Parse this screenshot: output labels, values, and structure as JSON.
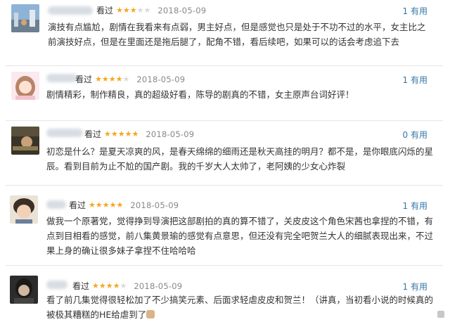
{
  "reviews": [
    {
      "rated_label": "看过",
      "rating": 3,
      "max_rating": 5,
      "date": "2018-05-09",
      "useful": "1 有用",
      "content": "演技有点尴尬，剧情在我看来有点弱，男主好点，但是感觉也只是处于不功不过的水平，女主比之前演技好点，但是在里面还是拖后腿了，配角不错，看后续吧，如果可以的话会考虑追下去",
      "avatar": "landscape-avatar"
    },
    {
      "rated_label": "看过",
      "rating": 4,
      "max_rating": 5,
      "date": "2018-05-09",
      "useful": "1 有用",
      "content": "剧情精彩，制作精良，真的超级好看，陈导的剧真的不错，女主原声台词好评！",
      "avatar": "girl-avatar"
    },
    {
      "rated_label": "看过",
      "rating": 5,
      "max_rating": 5,
      "date": "2018-05-09",
      "useful": "0 有用",
      "content": "初恋是什么？是夏天凉爽的风，是春天绵绵的细雨还是秋天高挂的明月？都不是，是你眼底闪烁的星辰。看到目前为止不尬的国产剧。我的千岁大人太帅了，老阿姨的少女心炸裂",
      "avatar": "photo-avatar"
    },
    {
      "rated_label": "看过",
      "rating": 5,
      "max_rating": 5,
      "date": "2018-05-09",
      "useful": "1 有用",
      "content": "做我一个原著党，觉得挣到导演把这部剧拍的真的算不错了，关皮皮这个角色宋茜也拿捏的不错，有点到目相看的感觉，前八集黄景瑜的感觉有点意思，但还没有完全吧贺兰大人的细腻表现出来，不过果上身的确让很多妹子拿捏不住哈哈哈",
      "avatar": "boy-avatar"
    },
    {
      "rated_label": "看过",
      "rating": 4,
      "max_rating": 5,
      "date": "2018-05-09",
      "useful": "1 有用",
      "content": "看了前几集觉得很轻松加了不少搞笑元素、后面求轻虐皮皮和贺兰！（讲真，当初看小说的时候真的被极其糟糕的HE给虐到了",
      "avatar": "dark-avatar"
    }
  ]
}
